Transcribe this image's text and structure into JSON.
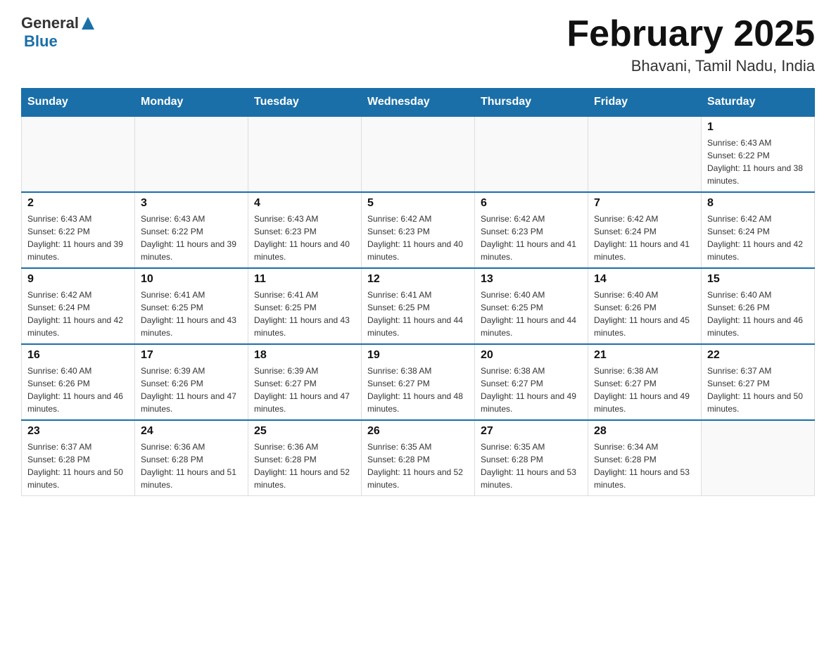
{
  "header": {
    "logo_general": "General",
    "logo_blue": "Blue",
    "title": "February 2025",
    "subtitle": "Bhavani, Tamil Nadu, India"
  },
  "days_of_week": [
    "Sunday",
    "Monday",
    "Tuesday",
    "Wednesday",
    "Thursday",
    "Friday",
    "Saturday"
  ],
  "weeks": [
    [
      {
        "day": "",
        "info": ""
      },
      {
        "day": "",
        "info": ""
      },
      {
        "day": "",
        "info": ""
      },
      {
        "day": "",
        "info": ""
      },
      {
        "day": "",
        "info": ""
      },
      {
        "day": "",
        "info": ""
      },
      {
        "day": "1",
        "info": "Sunrise: 6:43 AM\nSunset: 6:22 PM\nDaylight: 11 hours and 38 minutes."
      }
    ],
    [
      {
        "day": "2",
        "info": "Sunrise: 6:43 AM\nSunset: 6:22 PM\nDaylight: 11 hours and 39 minutes."
      },
      {
        "day": "3",
        "info": "Sunrise: 6:43 AM\nSunset: 6:22 PM\nDaylight: 11 hours and 39 minutes."
      },
      {
        "day": "4",
        "info": "Sunrise: 6:43 AM\nSunset: 6:23 PM\nDaylight: 11 hours and 40 minutes."
      },
      {
        "day": "5",
        "info": "Sunrise: 6:42 AM\nSunset: 6:23 PM\nDaylight: 11 hours and 40 minutes."
      },
      {
        "day": "6",
        "info": "Sunrise: 6:42 AM\nSunset: 6:23 PM\nDaylight: 11 hours and 41 minutes."
      },
      {
        "day": "7",
        "info": "Sunrise: 6:42 AM\nSunset: 6:24 PM\nDaylight: 11 hours and 41 minutes."
      },
      {
        "day": "8",
        "info": "Sunrise: 6:42 AM\nSunset: 6:24 PM\nDaylight: 11 hours and 42 minutes."
      }
    ],
    [
      {
        "day": "9",
        "info": "Sunrise: 6:42 AM\nSunset: 6:24 PM\nDaylight: 11 hours and 42 minutes."
      },
      {
        "day": "10",
        "info": "Sunrise: 6:41 AM\nSunset: 6:25 PM\nDaylight: 11 hours and 43 minutes."
      },
      {
        "day": "11",
        "info": "Sunrise: 6:41 AM\nSunset: 6:25 PM\nDaylight: 11 hours and 43 minutes."
      },
      {
        "day": "12",
        "info": "Sunrise: 6:41 AM\nSunset: 6:25 PM\nDaylight: 11 hours and 44 minutes."
      },
      {
        "day": "13",
        "info": "Sunrise: 6:40 AM\nSunset: 6:25 PM\nDaylight: 11 hours and 44 minutes."
      },
      {
        "day": "14",
        "info": "Sunrise: 6:40 AM\nSunset: 6:26 PM\nDaylight: 11 hours and 45 minutes."
      },
      {
        "day": "15",
        "info": "Sunrise: 6:40 AM\nSunset: 6:26 PM\nDaylight: 11 hours and 46 minutes."
      }
    ],
    [
      {
        "day": "16",
        "info": "Sunrise: 6:40 AM\nSunset: 6:26 PM\nDaylight: 11 hours and 46 minutes."
      },
      {
        "day": "17",
        "info": "Sunrise: 6:39 AM\nSunset: 6:26 PM\nDaylight: 11 hours and 47 minutes."
      },
      {
        "day": "18",
        "info": "Sunrise: 6:39 AM\nSunset: 6:27 PM\nDaylight: 11 hours and 47 minutes."
      },
      {
        "day": "19",
        "info": "Sunrise: 6:38 AM\nSunset: 6:27 PM\nDaylight: 11 hours and 48 minutes."
      },
      {
        "day": "20",
        "info": "Sunrise: 6:38 AM\nSunset: 6:27 PM\nDaylight: 11 hours and 49 minutes."
      },
      {
        "day": "21",
        "info": "Sunrise: 6:38 AM\nSunset: 6:27 PM\nDaylight: 11 hours and 49 minutes."
      },
      {
        "day": "22",
        "info": "Sunrise: 6:37 AM\nSunset: 6:27 PM\nDaylight: 11 hours and 50 minutes."
      }
    ],
    [
      {
        "day": "23",
        "info": "Sunrise: 6:37 AM\nSunset: 6:28 PM\nDaylight: 11 hours and 50 minutes."
      },
      {
        "day": "24",
        "info": "Sunrise: 6:36 AM\nSunset: 6:28 PM\nDaylight: 11 hours and 51 minutes."
      },
      {
        "day": "25",
        "info": "Sunrise: 6:36 AM\nSunset: 6:28 PM\nDaylight: 11 hours and 52 minutes."
      },
      {
        "day": "26",
        "info": "Sunrise: 6:35 AM\nSunset: 6:28 PM\nDaylight: 11 hours and 52 minutes."
      },
      {
        "day": "27",
        "info": "Sunrise: 6:35 AM\nSunset: 6:28 PM\nDaylight: 11 hours and 53 minutes."
      },
      {
        "day": "28",
        "info": "Sunrise: 6:34 AM\nSunset: 6:28 PM\nDaylight: 11 hours and 53 minutes."
      },
      {
        "day": "",
        "info": ""
      }
    ]
  ]
}
